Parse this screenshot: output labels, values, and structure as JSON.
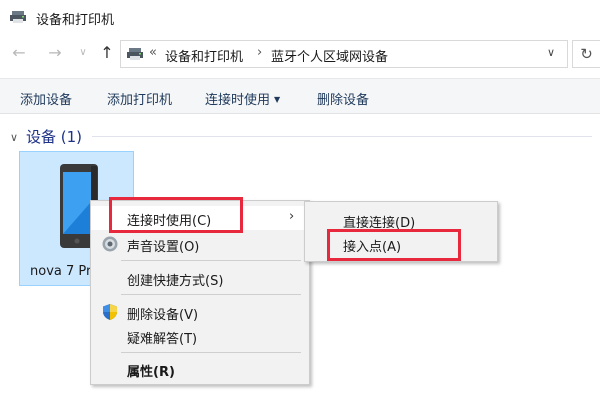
{
  "window": {
    "title": "设备和打印机",
    "icon": "devices-printers-icon"
  },
  "nav": {
    "back": "←",
    "forward": "→",
    "dropdown": "∨",
    "up": "↑",
    "breadcrumb_overflow": "«",
    "breadcrumb": [
      "设备和打印机",
      "蓝牙个人区域网设备"
    ],
    "breadcrumb_sep": "›",
    "address_dropdown": "∨",
    "refresh": "↻"
  },
  "commands": [
    {
      "label": "添加设备"
    },
    {
      "label": "添加打印机"
    },
    {
      "label": "连接时使用",
      "has_dropdown": true
    },
    {
      "label": "删除设备"
    }
  ],
  "group": {
    "title": "设备 (1)",
    "chevron": "∨"
  },
  "device": {
    "name": "nova 7 Pro",
    "visible_label": "nova 7 Pr",
    "icon": "smartphone-icon"
  },
  "context_menu": {
    "items": [
      {
        "label": "连接时使用(C)",
        "has_submenu": true,
        "highlighted": true,
        "submenu_arrow": "›"
      },
      {
        "label": "声音设置(O)",
        "icon": "speaker-icon"
      },
      {
        "label": "创建快捷方式(S)"
      },
      {
        "label": "删除设备(V)",
        "icon": "uac-shield-icon"
      },
      {
        "label": "疑难解答(T)"
      },
      {
        "label": "属性(R)",
        "bold": true
      }
    ]
  },
  "submenu": {
    "items": [
      {
        "label": "直接连接(D)"
      },
      {
        "label": "接入点(A)"
      }
    ]
  },
  "colors": {
    "highlight_box": "#e8283c",
    "selection_fill": "#cce8ff",
    "selection_border": "#99d1ff",
    "group_header": "#1e3287",
    "command_text": "#1e395b",
    "menu_bg": "#f2f2f2"
  }
}
